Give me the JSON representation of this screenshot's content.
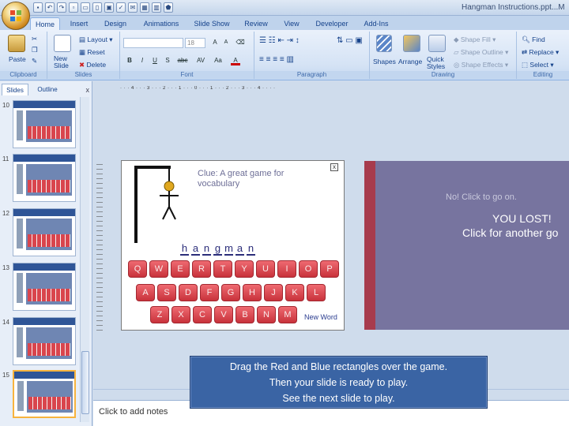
{
  "app": {
    "title": "Hangman Instructions.ppt...M",
    "quick_access_icons": [
      "save-icon",
      "undo-icon",
      "redo-icon",
      "new-icon",
      "open-icon",
      "print-icon",
      "preview-icon",
      "spelling-icon",
      "email-icon",
      "table-icon",
      "chart-icon",
      "shapes-icon"
    ]
  },
  "tabs": [
    {
      "label": "Home",
      "active": true
    },
    {
      "label": "Insert"
    },
    {
      "label": "Design"
    },
    {
      "label": "Animations"
    },
    {
      "label": "Slide Show"
    },
    {
      "label": "Review"
    },
    {
      "label": "View"
    },
    {
      "label": "Developer"
    },
    {
      "label": "Add-Ins"
    }
  ],
  "ribbon": {
    "clipboard": {
      "label": "Clipboard",
      "paste": "Paste"
    },
    "slides": {
      "label": "Slides",
      "new_slide": "New Slide",
      "layout": "Layout",
      "reset": "Reset",
      "delete": "Delete"
    },
    "font": {
      "label": "Font",
      "size": "18",
      "buttons": [
        "B",
        "I",
        "U",
        "S",
        "abc",
        "AV",
        "Aa",
        "A"
      ]
    },
    "paragraph": {
      "label": "Paragraph"
    },
    "drawing": {
      "label": "Drawing",
      "shapes": "Shapes",
      "arrange": "Arrange",
      "quick_styles": "Quick Styles",
      "shape_fill": "Shape Fill",
      "shape_outline": "Shape Outline",
      "shape_effects": "Shape Effects"
    },
    "editing": {
      "label": "Editing",
      "find": "Find",
      "replace": "Replace",
      "select": "Select"
    }
  },
  "left_panel": {
    "tabs": [
      "Slides",
      "Outline"
    ],
    "close": "x",
    "slides": [
      {
        "number": "10"
      },
      {
        "number": "11"
      },
      {
        "number": "12"
      },
      {
        "number": "13"
      },
      {
        "number": "14"
      },
      {
        "number": "15",
        "selected": true
      }
    ]
  },
  "slide": {
    "clue": "Clue: A great game for vocabulary",
    "close": "x",
    "word_letters": [
      "h",
      "a",
      "n",
      "g",
      "m",
      "a",
      "n"
    ],
    "keyboard_rows": [
      [
        "Q",
        "W",
        "E",
        "R",
        "T",
        "Y",
        "U",
        "I",
        "O",
        "P"
      ],
      [
        "A",
        "S",
        "D",
        "F",
        "G",
        "H",
        "J",
        "K",
        "L"
      ],
      [
        "Z",
        "X",
        "C",
        "V",
        "B",
        "N",
        "M"
      ]
    ],
    "new_word": "New Word"
  },
  "lost_slide": {
    "no_click": "No! Click to go on.",
    "you_lost": "YOU LOST!",
    "click_another": "Click for another go"
  },
  "instruction_box": {
    "line1": "Drag the Red and Blue rectangles over the game.",
    "line2": "Then your slide is ready to play.",
    "line3": "See the next slide to play."
  },
  "notes": {
    "placeholder": "Click to add notes"
  },
  "colors": {
    "ribbon": "#dae6f5",
    "key_red": "#d9454d",
    "lost_bg": "#77749f",
    "accent_red": "#a73b4d",
    "box_blue": "#3a64a4"
  }
}
